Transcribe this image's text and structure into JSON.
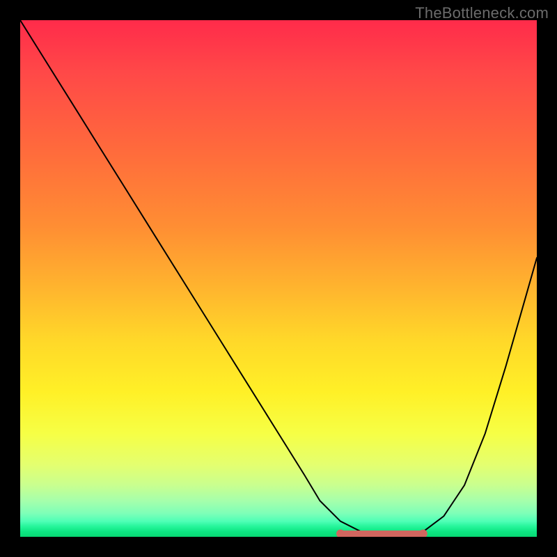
{
  "watermark": "TheBottleneck.com",
  "colors": {
    "curve": "#000000",
    "marker_stroke": "#d1665f",
    "marker_fill": "#d1665f",
    "background_black": "#000000"
  },
  "chart_data": {
    "type": "line",
    "title": "",
    "xlabel": "",
    "ylabel": "",
    "xlim": [
      0,
      100
    ],
    "ylim": [
      0,
      100
    ],
    "grid": false,
    "legend": false,
    "series": [
      {
        "name": "bottleneck-curve",
        "x": [
          0,
          5,
          10,
          15,
          20,
          25,
          30,
          35,
          40,
          45,
          50,
          55,
          58,
          62,
          66,
          70,
          74,
          78,
          82,
          86,
          90,
          94,
          98,
          100
        ],
        "y": [
          100,
          92,
          84,
          76,
          68,
          60,
          52,
          44,
          36,
          28,
          20,
          12,
          7,
          3,
          1,
          0.4,
          0.4,
          1,
          4,
          10,
          20,
          33,
          47,
          54
        ]
      }
    ],
    "markers": [
      {
        "name": "flat-region-start",
        "x": 62,
        "y": 0.6
      },
      {
        "name": "flat-region-end",
        "x": 78,
        "y": 0.6
      }
    ],
    "flat_segment": {
      "x0": 62,
      "x1": 78,
      "y": 0.6
    }
  }
}
